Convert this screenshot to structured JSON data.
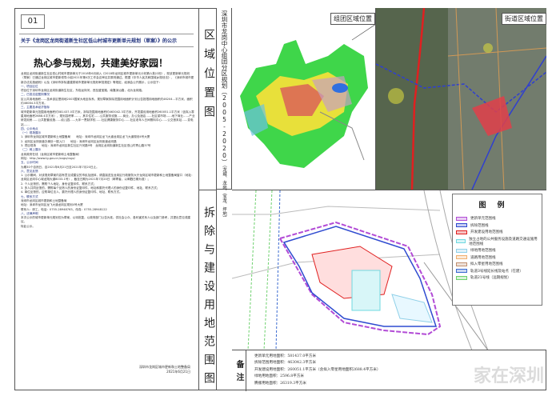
{
  "page_number": "01",
  "notice": {
    "title": "关于《龙岗区龙岗街道新生社区低山村城市更新单元规划（草案）》的公示",
    "slogan": "热心参与规划，共建美好家园！",
    "paragraphs": [
      "龙岗区龙岗街道新生社区低山村城市更新单元于2018年6月纳入《2018年龙岗区城市更新单元计划第六批计划》，现该更新单元规划（草案）已通过龙岗区城市更新领导小组2021年第4次工作会议审议并原则通过。根据《中华人民共和国城乡规划法》、《深圳市城市更新办法实施细则》以及《深圳市拆除重建类城市更新单元规划审批规定》等规定，经我会公开展示，公示如下：",
      "一、项目区位",
      "项目位于深圳市龙岗区龙岗街道新生社区，东临龙岗河，西至盛宝路，南靠深汕路，北为龙岗路。",
      "二、已批法定图则情况",
      "区公共用地面积……技术该区是用地2003国家大地坐标系，规划草案拆除范围用地面积计划公告批限用地面积约46204…平方米，面积约46084.3平方米。",
      "三、主要技术经济指标",
      "城市更新单元范围用地面积约581437.0平方米，拆除范围用地面积约463042.3平方米，开发建设用地面积260051.1平方米（含拟入零星用地面积2688.4平方米），规划容积率……，其中住宅……公共服务设施……商业、办公及酒店……社区菜市场……地下商业……产业研发用房……公共配套设施……幼儿园……九年一贯制学校……社区健康服务中心……社区老年人日间照料中心……公交首末站……变电站……",
      "四、公示地点",
      "（一）现场展示",
      "1. 深圳市龙岗区城市更新和土地整备局　　地址：深圳市龙岗区龙飞大道龙岗区龙飞大道规划4号大厦",
      "2. 龙岗区龙岗街道办事处一楼入口　　地址：深圳市龙岗区龙岗街道龙岗路",
      "3. 项目现场　　地址：深圳市龙岗区新生社区兴河路9号　龙岗区龙岗街道新生社区低山村青山路37号",
      "（二）网上展示",
      "龙岗政府在线（龙岗区城市更新和土地整备局）",
      "网址：http://www.lg.gov.cn/xxgs/csgx/",
      "五、公示时间",
      "为期30个自然日，自2021年6月21日至2021年7月20日止。",
      "六、意见反馈",
      "1. 公示期间，对该规划草案内容有意见或建议的市民及团体，请直接送至龙岗区行政服务大厅龙岗区城市更新和土地整备局窗口（地址：龙岗区龙岗中心城龙翔大道8033-1号），截至日期为2021年7月20日（邮寄者，以邮戳日期为准）；",
      "2. 个人反馈的，需附个人地址、身份证复印件、联系方式；",
      "3. 多人共同反馈的，需附每个反馈人的身份证复印件、地址和委托代理人的身份证复印件、地址、联系方式；",
      "4. 单位反馈的，应附单位法人、委托代理人的身份证复印件、地址、联系方式。",
      "七、联系方式",
      "深圳市龙岗区城市更新和土地整备局",
      "地址：深圳市龙岗区龙飞大道龙岗区规划4号大厦",
      "联系人：邱工，电话：0755-28948763，传真：0755-28948122",
      "八、法律声明",
      "本次公示的城市更新单元规划仅为草案，以待批复，以政府部门公告为准。供社会公众、各利害关系人以及部门参考，并提出意见或建议。",
      "特此公示。"
    ],
    "signature": "深圳市龙岗区城市更新和土地整备局",
    "date": "2021年6月21日"
  },
  "section_titles": {
    "location": "区域位置图",
    "location_sub": "深圳市龙岗中心组团分区规划（2005-2020）",
    "location_sub_note": "（龙城、龙岗、宝龙、坪地）",
    "demolition": "拆除与建设用地范围图",
    "notes": "备注"
  },
  "maps": {
    "group_label": "组团区域位置",
    "street_label": "街道区域位置"
  },
  "legend": {
    "title": "图例",
    "items": [
      {
        "label": "更新单元范围线",
        "color": "#b24bd6"
      },
      {
        "label": "拆除范围线",
        "color": "#2f4bd0"
      },
      {
        "label": "开发建设用地范围线",
        "color": "#e02020"
      },
      {
        "label": "独立占地的公共服务设施及道路交通设施用地范围线",
        "color": "#6fd8e0"
      },
      {
        "label": "绿地用地范围线",
        "color": "#8fd0e8"
      },
      {
        "label": "道路用地范围线",
        "color": "#f0b070"
      },
      {
        "label": "拟入零星用地范围线",
        "color": "#c09070"
      },
      {
        "label": "轨道3号线延长线及站点（在建）",
        "color": "#3a6ad0"
      },
      {
        "label": "轨道21号线（远期规划）",
        "color": "#6cd06c"
      }
    ]
  },
  "remarks": [
    "更新单元用地面积：581437.0平方米",
    "拆除范围用地面积：463042.3平方米",
    "开发建设用地面积：260051.1平方米（含拟入零星用地面积2688.4平方米）",
    "绿地用地面积：2596.8平方米",
    "腾挪用地面积：26319.3平方米"
  ],
  "watermark": "家在深圳"
}
